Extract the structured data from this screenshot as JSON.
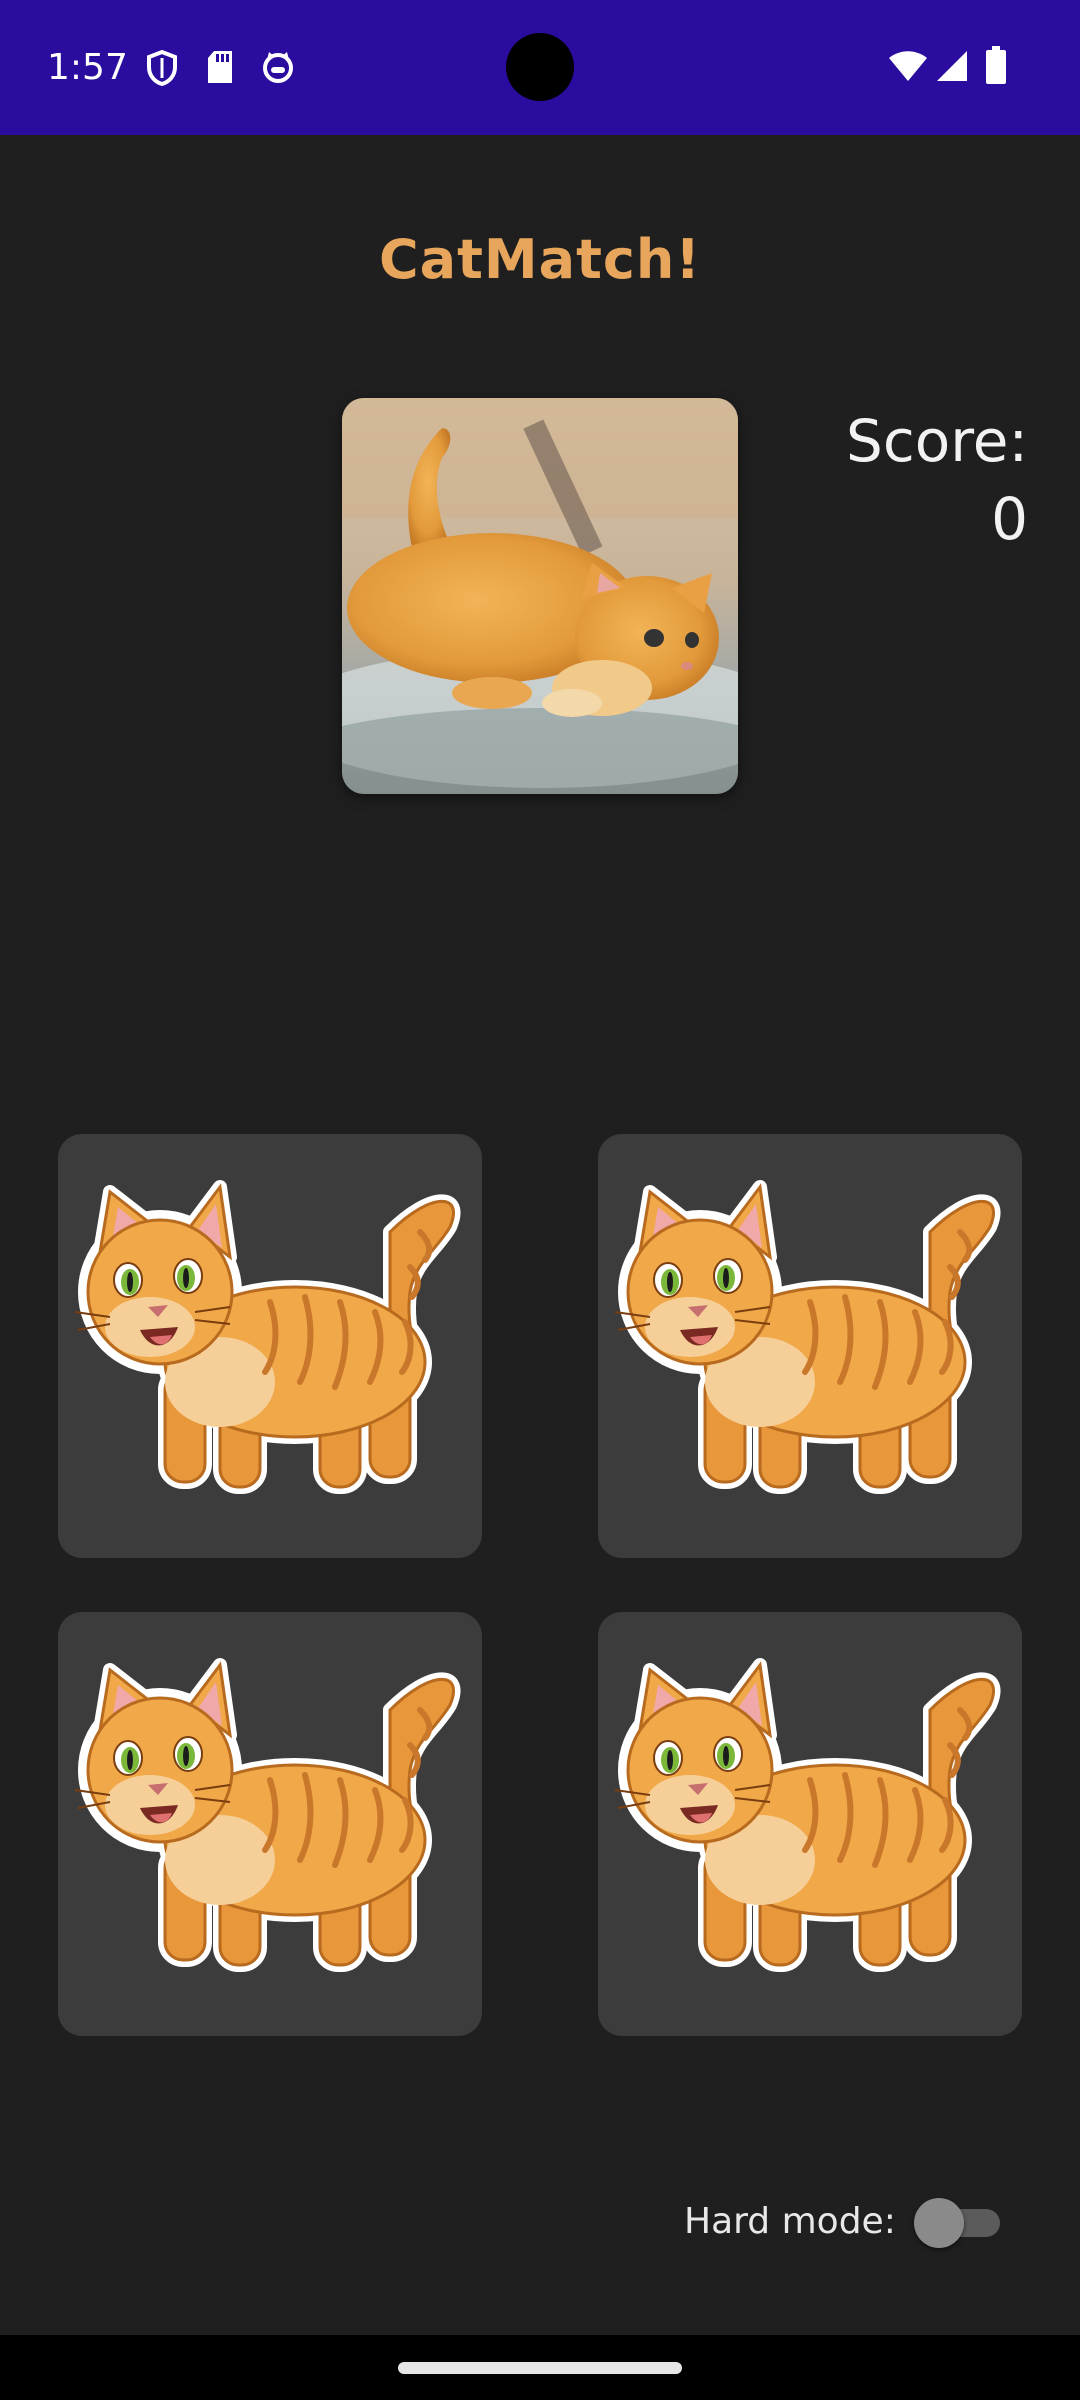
{
  "status_bar": {
    "time": "1:57",
    "left_icons": [
      "shield-icon",
      "sd-card-icon",
      "cat-face-icon"
    ],
    "right_icons": [
      "wifi-icon",
      "cell-signal-icon",
      "battery-icon"
    ]
  },
  "app": {
    "title": "CatMatch!",
    "target_image": "kitten-photo",
    "score_label": "Score:",
    "score_value": "0"
  },
  "cards": [
    {
      "image": "cartoon-cat-icon"
    },
    {
      "image": "cartoon-cat-icon"
    },
    {
      "image": "cartoon-cat-icon"
    },
    {
      "image": "cartoon-cat-icon"
    }
  ],
  "settings": {
    "hard_mode_label": "Hard mode:",
    "hard_mode_enabled": false
  },
  "colors": {
    "status_bar": "#2a0c9e",
    "background": "#1f1f1f",
    "title": "#e8a55c",
    "card": "#3c3c3c"
  }
}
